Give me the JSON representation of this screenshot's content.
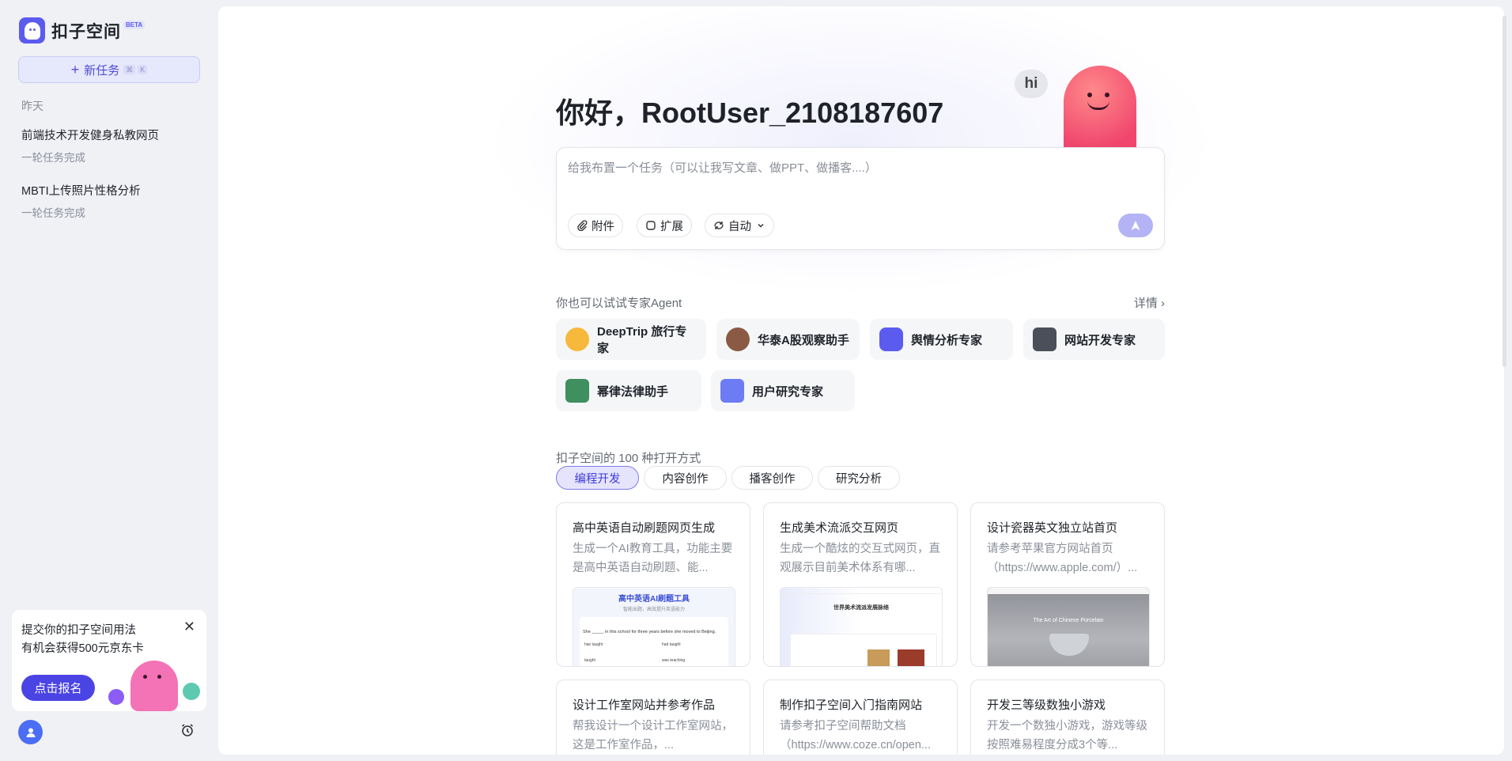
{
  "app": {
    "name": "扣子空间",
    "badge": "BETA"
  },
  "sidebar": {
    "new_task": {
      "label": "新任务",
      "kbd1": "⌘",
      "kbd2": "K"
    },
    "section": "昨天",
    "history": [
      {
        "title": "前端技术开发健身私教网页",
        "status": "一轮任务完成"
      },
      {
        "title": "MBTI上传照片性格分析",
        "status": "一轮任务完成"
      }
    ],
    "promo": {
      "line1": "提交你的扣子空间用法",
      "line2": "有机会获得500元京东卡",
      "button": "点击报名",
      "close": "✕"
    }
  },
  "main": {
    "greeting": "你好，RootUser_2108187607",
    "hi": "hi",
    "composer": {
      "placeholder": "给我布置一个任务（可以让我写文章、做PPT、做播客....）",
      "attach": "附件",
      "expand": "扩展",
      "mode": "自动"
    },
    "agents": {
      "heading": "你也可以试试专家Agent",
      "detail": "详情 ›",
      "items": [
        {
          "label": "DeepTrip 旅行专家",
          "color": "#f6b93b"
        },
        {
          "label": "华泰A股观察助手",
          "color": "#8a5a44"
        },
        {
          "label": "舆情分析专家",
          "color": "#5b5bf0"
        },
        {
          "label": "网站开发专家",
          "color": "#4a4f5a"
        },
        {
          "label": "幂律法律助手",
          "color": "#3f8f5f"
        },
        {
          "label": "用户研究专家",
          "color": "#6d7cf5"
        }
      ]
    },
    "ways": {
      "heading": "扣子空间的 100 种打开方式",
      "tabs": [
        "编程开发",
        "内容创作",
        "播客创作",
        "研究分析"
      ]
    },
    "cards": [
      {
        "title": "高中英语自动刷题网页生成",
        "desc": "生成一个AI教育工具，功能主要是高中英语自动刷题、能...",
        "thumb_title": "高中英语AI刷题工具",
        "thumb_sub": "智能出题，高效提升英语能力",
        "thumb_q": "She _____ in this school for three years before she moved to Beijing.",
        "thumb_opts": [
          "has taught",
          "had taught",
          "taught",
          "was teaching"
        ]
      },
      {
        "title": "生成美术流派交互网页",
        "desc": "生成一个酷炫的交互式网页，直观展示目前美术体系有哪...",
        "thumb_title": "世界美术流派发展脉络"
      },
      {
        "title": "设计瓷器英文独立站首页",
        "desc": "请参考苹果官方网站首页（https://www.apple.com/）...",
        "thumb_title": "The Art of Chinese Porcelain"
      },
      {
        "title": "设计工作室网站并参考作品",
        "desc": "帮我设计一个设计工作室网站，这是工作室作品，..."
      },
      {
        "title": "制作扣子空间入门指南网站",
        "desc": "请参考扣子空间帮助文档（https://www.coze.cn/open..."
      },
      {
        "title": "开发三等级数独小游戏",
        "desc": "开发一个数独小游戏，游戏等级按照难易程度分成3个等..."
      }
    ]
  }
}
